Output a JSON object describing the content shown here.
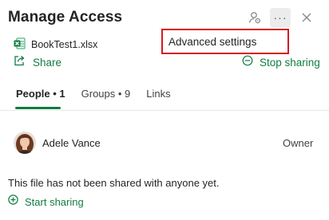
{
  "header": {
    "title": "Manage Access",
    "icons": [
      "person-settings-icon",
      "more-icon",
      "close-icon"
    ]
  },
  "menu": {
    "items": [
      {
        "label": "Advanced settings"
      }
    ]
  },
  "file": {
    "name": "BookTest1.xlsx",
    "icon": "excel-file-icon"
  },
  "actions": {
    "share_label": "Share",
    "stop_sharing_label": "Stop sharing"
  },
  "tabs": [
    {
      "label": "People • 1",
      "active": true
    },
    {
      "label": "Groups • 9",
      "active": false
    },
    {
      "label": "Links",
      "active": false
    }
  ],
  "people": [
    {
      "name": "Adele Vance",
      "role": "Owner"
    }
  ],
  "empty_state": {
    "message": "This file has not been shared with anyone yet.",
    "start_sharing_label": "Start sharing"
  },
  "colors": {
    "accent": "#107c41",
    "highlight_border": "#d71920"
  }
}
